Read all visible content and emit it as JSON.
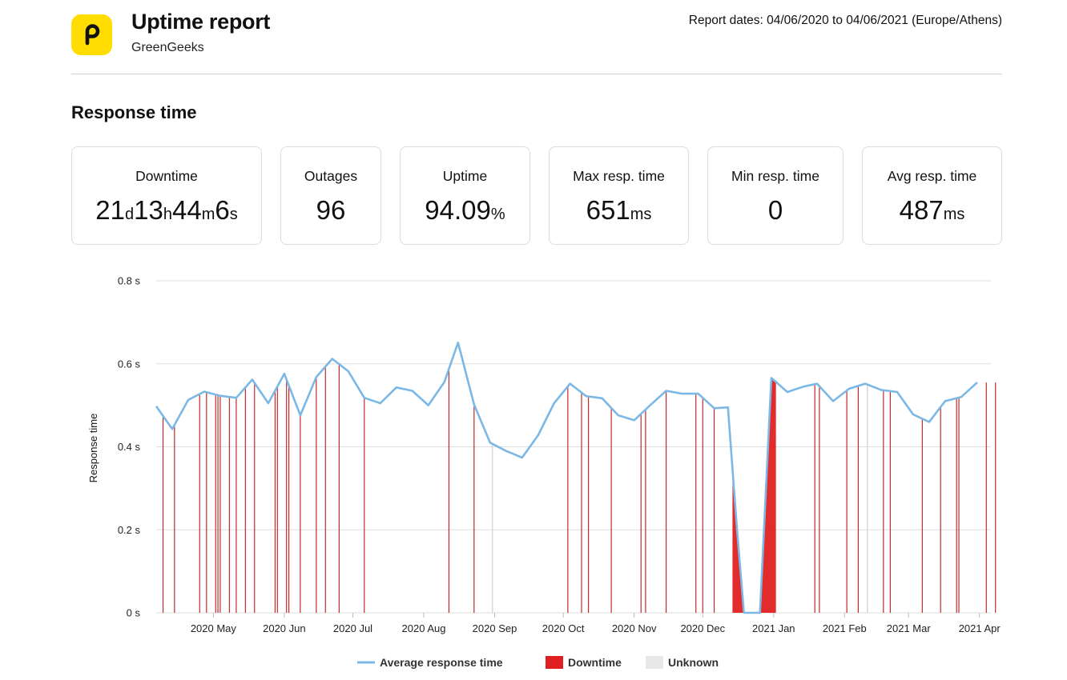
{
  "header": {
    "title": "Uptime report",
    "subtitle": "GreenGeeks",
    "report_dates": "Report dates: 04/06/2020 to 04/06/2021 (Europe/Athens)"
  },
  "section_title": "Response time",
  "stats": {
    "downtime": {
      "label": "Downtime",
      "d": "21",
      "d_unit": "d",
      "h": "13",
      "h_unit": "h",
      "m": "44",
      "m_unit": "m",
      "s": "6",
      "s_unit": "s"
    },
    "outages": {
      "label": "Outages",
      "value": "96"
    },
    "uptime": {
      "label": "Uptime",
      "value": "94.09",
      "unit": "%"
    },
    "max_resp": {
      "label": "Max resp. time",
      "value": "651",
      "unit": "ms"
    },
    "min_resp": {
      "label": "Min resp. time",
      "value": "0"
    },
    "avg_resp": {
      "label": "Avg resp. time",
      "value": "487",
      "unit": "ms"
    }
  },
  "colors": {
    "line": "#7cb8e6",
    "downtime": "#e02020",
    "unknown": "#e8e8e8",
    "grid": "#dddddd",
    "logo": "#ffdd00"
  },
  "chart_data": {
    "type": "line",
    "ylabel": "Response time",
    "ylim": [
      0,
      0.8
    ],
    "y_ticks": [
      {
        "value": 0,
        "label": "0 s"
      },
      {
        "value": 0.2,
        "label": "0.2 s"
      },
      {
        "value": 0.4,
        "label": "0.4 s"
      },
      {
        "value": 0.6,
        "label": "0.6 s"
      },
      {
        "value": 0.8,
        "label": "0.8 s"
      }
    ],
    "xlim": [
      "2020-04-06",
      "2021-04-06"
    ],
    "x_ticks": [
      {
        "date": "2020-05-01",
        "label": "2020 May"
      },
      {
        "date": "2020-06-01",
        "label": "2020 Jun"
      },
      {
        "date": "2020-07-01",
        "label": "2020 Jul"
      },
      {
        "date": "2020-08-01",
        "label": "2020 Aug"
      },
      {
        "date": "2020-09-01",
        "label": "2020 Sep"
      },
      {
        "date": "2020-10-01",
        "label": "2020 Oct"
      },
      {
        "date": "2020-11-01",
        "label": "2020 Nov"
      },
      {
        "date": "2020-12-01",
        "label": "2020 Dec"
      },
      {
        "date": "2021-01-01",
        "label": "2021 Jan"
      },
      {
        "date": "2021-02-01",
        "label": "2021 Feb"
      },
      {
        "date": "2021-03-01",
        "label": "2021 Mar"
      },
      {
        "date": "2021-04-01",
        "label": "2021 Apr"
      }
    ],
    "series": [
      {
        "name": "Average response time",
        "points": [
          [
            "2020-04-06",
            0.498
          ],
          [
            "2020-04-13",
            0.443
          ],
          [
            "2020-04-20",
            0.513
          ],
          [
            "2020-04-27",
            0.533
          ],
          [
            "2020-05-04",
            0.523
          ],
          [
            "2020-05-11",
            0.518
          ],
          [
            "2020-05-18",
            0.562
          ],
          [
            "2020-05-25",
            0.505
          ],
          [
            "2020-06-01",
            0.576
          ],
          [
            "2020-06-08",
            0.476
          ],
          [
            "2020-06-15",
            0.568
          ],
          [
            "2020-06-22",
            0.612
          ],
          [
            "2020-06-29",
            0.582
          ],
          [
            "2020-07-06",
            0.518
          ],
          [
            "2020-07-13",
            0.505
          ],
          [
            "2020-07-20",
            0.543
          ],
          [
            "2020-07-27",
            0.535
          ],
          [
            "2020-08-03",
            0.5
          ],
          [
            "2020-08-10",
            0.556
          ],
          [
            "2020-08-16",
            0.651
          ],
          [
            "2020-08-23",
            0.502
          ],
          [
            "2020-08-30",
            0.41
          ],
          [
            "2020-09-06",
            0.39
          ],
          [
            "2020-09-13",
            0.374
          ],
          [
            "2020-09-20",
            0.428
          ],
          [
            "2020-09-27",
            0.505
          ],
          [
            "2020-10-04",
            0.552
          ],
          [
            "2020-10-11",
            0.522
          ],
          [
            "2020-10-18",
            0.517
          ],
          [
            "2020-10-25",
            0.476
          ],
          [
            "2020-11-01",
            0.464
          ],
          [
            "2020-11-08",
            0.5
          ],
          [
            "2020-11-15",
            0.535
          ],
          [
            "2020-11-22",
            0.528
          ],
          [
            "2020-11-29",
            0.528
          ],
          [
            "2020-12-06",
            0.493
          ],
          [
            "2020-12-12",
            0.495
          ],
          [
            "2020-12-16",
            0.2
          ],
          [
            "2020-12-19",
            0
          ],
          [
            "2020-12-26",
            0
          ],
          [
            "2020-12-31",
            0.566
          ],
          [
            "2021-01-07",
            0.532
          ],
          [
            "2021-01-14",
            0.545
          ],
          [
            "2021-01-20",
            0.552
          ],
          [
            "2021-01-27",
            0.51
          ],
          [
            "2021-02-03",
            0.54
          ],
          [
            "2021-02-10",
            0.552
          ],
          [
            "2021-02-17",
            0.537
          ],
          [
            "2021-02-24",
            0.532
          ],
          [
            "2021-03-03",
            0.478
          ],
          [
            "2021-03-10",
            0.46
          ],
          [
            "2021-03-17",
            0.51
          ],
          [
            "2021-03-24",
            0.52
          ],
          [
            "2021-03-31",
            0.555
          ]
        ]
      }
    ],
    "downtime_events": [
      "2020-04-09",
      "2020-04-14",
      "2020-04-25",
      "2020-04-28",
      "2020-05-02",
      "2020-05-03",
      "2020-05-04",
      "2020-05-08",
      "2020-05-11",
      "2020-05-15",
      "2020-05-19",
      "2020-05-28",
      "2020-05-29",
      "2020-06-02",
      "2020-06-03",
      "2020-06-08",
      "2020-06-15",
      "2020-06-19",
      "2020-06-25",
      "2020-07-06",
      "2020-08-12",
      "2020-08-23",
      "2020-10-03",
      "2020-10-09",
      "2020-10-12",
      "2020-10-22",
      "2020-11-04",
      "2020-11-06",
      "2020-11-15",
      "2020-11-28",
      "2020-12-01",
      "2020-12-06",
      "2021-01-19",
      "2021-01-21",
      "2021-02-02",
      "2021-02-07",
      "2021-02-18",
      "2021-02-21",
      "2021-03-07",
      "2021-03-15",
      "2021-03-22",
      "2021-03-23",
      "2021-04-04",
      "2021-04-08"
    ],
    "downtime_periods": [
      {
        "start": "2020-12-14",
        "end": "2020-12-19"
      },
      {
        "start": "2020-12-26",
        "end": "2021-01-02"
      }
    ],
    "unknown_events": [
      "2020-08-31",
      "2021-02-11"
    ],
    "legend": [
      {
        "key": "line",
        "label": "Average response time"
      },
      {
        "key": "downtime",
        "label": "Downtime"
      },
      {
        "key": "unknown",
        "label": "Unknown"
      }
    ],
    "legend_position": "bottom-center",
    "grid": true
  }
}
